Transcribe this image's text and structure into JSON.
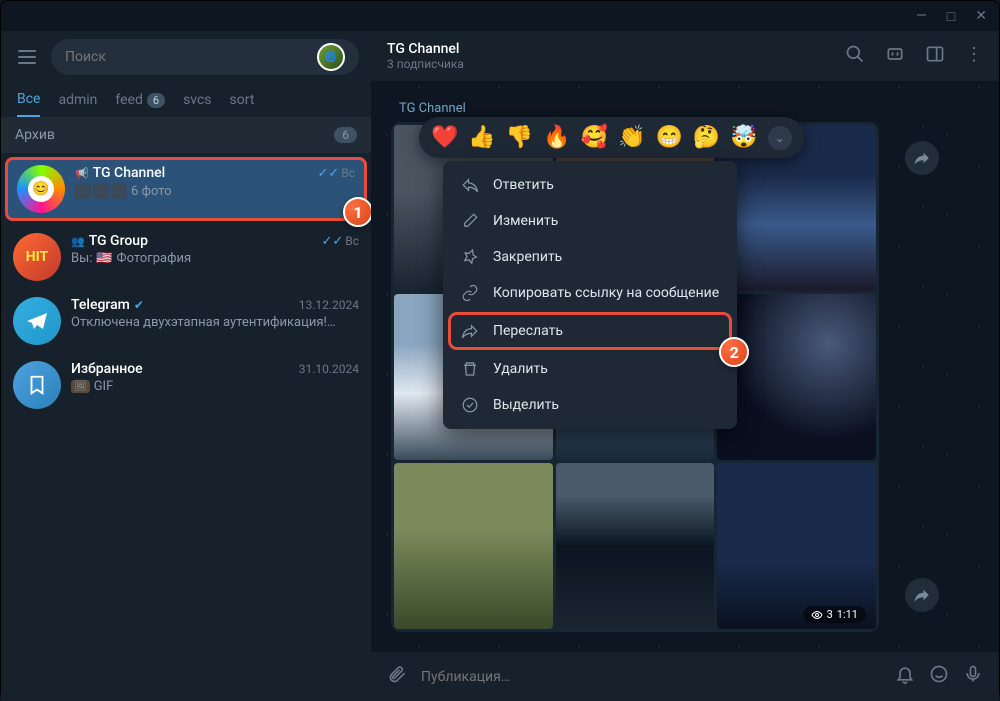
{
  "titlebar": {
    "min": "—",
    "max": "□",
    "close": "✕"
  },
  "search": {
    "placeholder": "Поиск"
  },
  "folders": [
    {
      "label": "Все",
      "active": true
    },
    {
      "label": "admin"
    },
    {
      "label": "feed",
      "badge": "6"
    },
    {
      "label": "svcs"
    },
    {
      "label": "sort"
    }
  ],
  "archive": {
    "label": "Архив",
    "count": "6"
  },
  "chats": [
    {
      "id": "tgchannel",
      "title": "TG Channel",
      "icon": "📢",
      "time": "Вс",
      "checks": "✓✓",
      "preview": "6 фото",
      "thumbs": 3,
      "avatar_bg": "conic-gradient(#7fff00,#ff8c00,#ff1493,#1e90ff,#7fff00)",
      "avatar_icon": "⚙",
      "selected": true,
      "highlighted": true
    },
    {
      "id": "tggroup",
      "title": "TG Group",
      "icon": "👥",
      "time": "Вс",
      "checks": "✓✓",
      "preview": "Фотография",
      "you": "Вы:",
      "flag": "🇺🇸",
      "avatar_bg": "linear-gradient(135deg,#ff6b35,#c0392b)",
      "avatar_text": "HIT"
    },
    {
      "id": "telegram",
      "title": "Telegram",
      "verified": true,
      "time": "13.12.2024",
      "preview": "Отключена двухэтапная аутентификация!…",
      "avatar_bg": "linear-gradient(135deg,#37aee2,#1e96c8)",
      "avatar_icon": "➤"
    },
    {
      "id": "saved",
      "title": "Избранное",
      "time": "31.10.2024",
      "preview": "GIF",
      "gif_badge": "🖼",
      "avatar_bg": "linear-gradient(135deg,#4fa3e0,#2980b9)",
      "avatar_icon": "🔖"
    }
  ],
  "header": {
    "title": "TG Channel",
    "sub": "3 подписчика"
  },
  "sender": "TG Channel",
  "msg_meta": {
    "views": "3",
    "time": "1:11"
  },
  "reactions": [
    "❤️",
    "👍",
    "👎",
    "🔥",
    "🥰",
    "👏",
    "😁",
    "🤔",
    "🤯"
  ],
  "menu": [
    {
      "icon": "reply",
      "label": "Ответить"
    },
    {
      "icon": "edit",
      "label": "Изменить"
    },
    {
      "icon": "pin",
      "label": "Закрепить"
    },
    {
      "icon": "link",
      "label": "Копировать ссылку на сообщение"
    },
    {
      "icon": "forward",
      "label": "Переслать",
      "highlighted": true
    },
    {
      "icon": "delete",
      "label": "Удалить"
    },
    {
      "icon": "select",
      "label": "Выделить"
    }
  ],
  "composer": {
    "placeholder": "Публикация…"
  },
  "markers": {
    "one": "1",
    "two": "2"
  }
}
